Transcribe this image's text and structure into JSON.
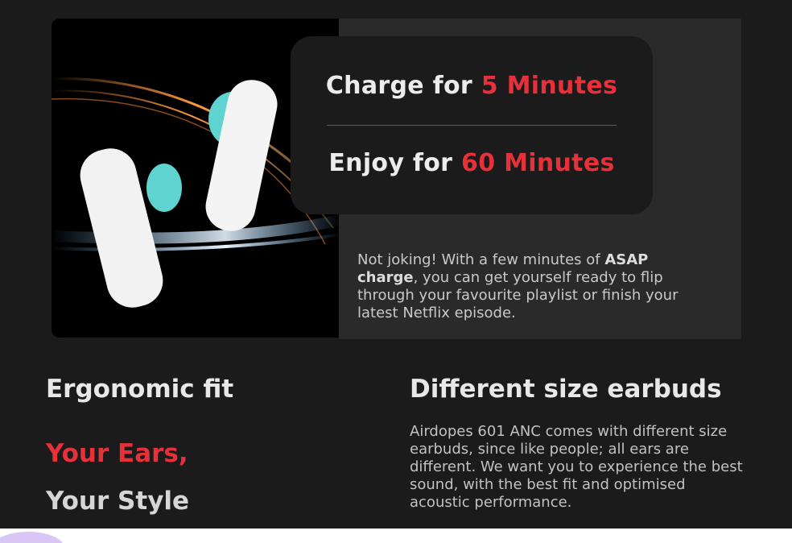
{
  "colors": {
    "accent": "#e6303a",
    "background": "#1b1b1c",
    "panel": "#2a2a2b"
  },
  "charge": {
    "line1_prefix": "Charge for ",
    "line1_accent": "5 Minutes",
    "line2_prefix": "Enjoy for ",
    "line2_accent": "60 Minutes"
  },
  "panel": {
    "text_before": "Not joking! With a few minutes of ",
    "text_bold": "ASAP charge",
    "text_after": ", you can get yourself ready to flip through your favourite playlist or finish your latest Netflix episode."
  },
  "fit": {
    "heading": "Ergonomic fit",
    "line_accent": "Your Ears,",
    "line_plain": "Your Style"
  },
  "sizes": {
    "heading": "Different size earbuds",
    "body": "Airdopes 601 ANC comes with different size earbuds, since like people; all ears are different. We want you to experience the best sound, with the best fit and optimised acoustic performance."
  }
}
